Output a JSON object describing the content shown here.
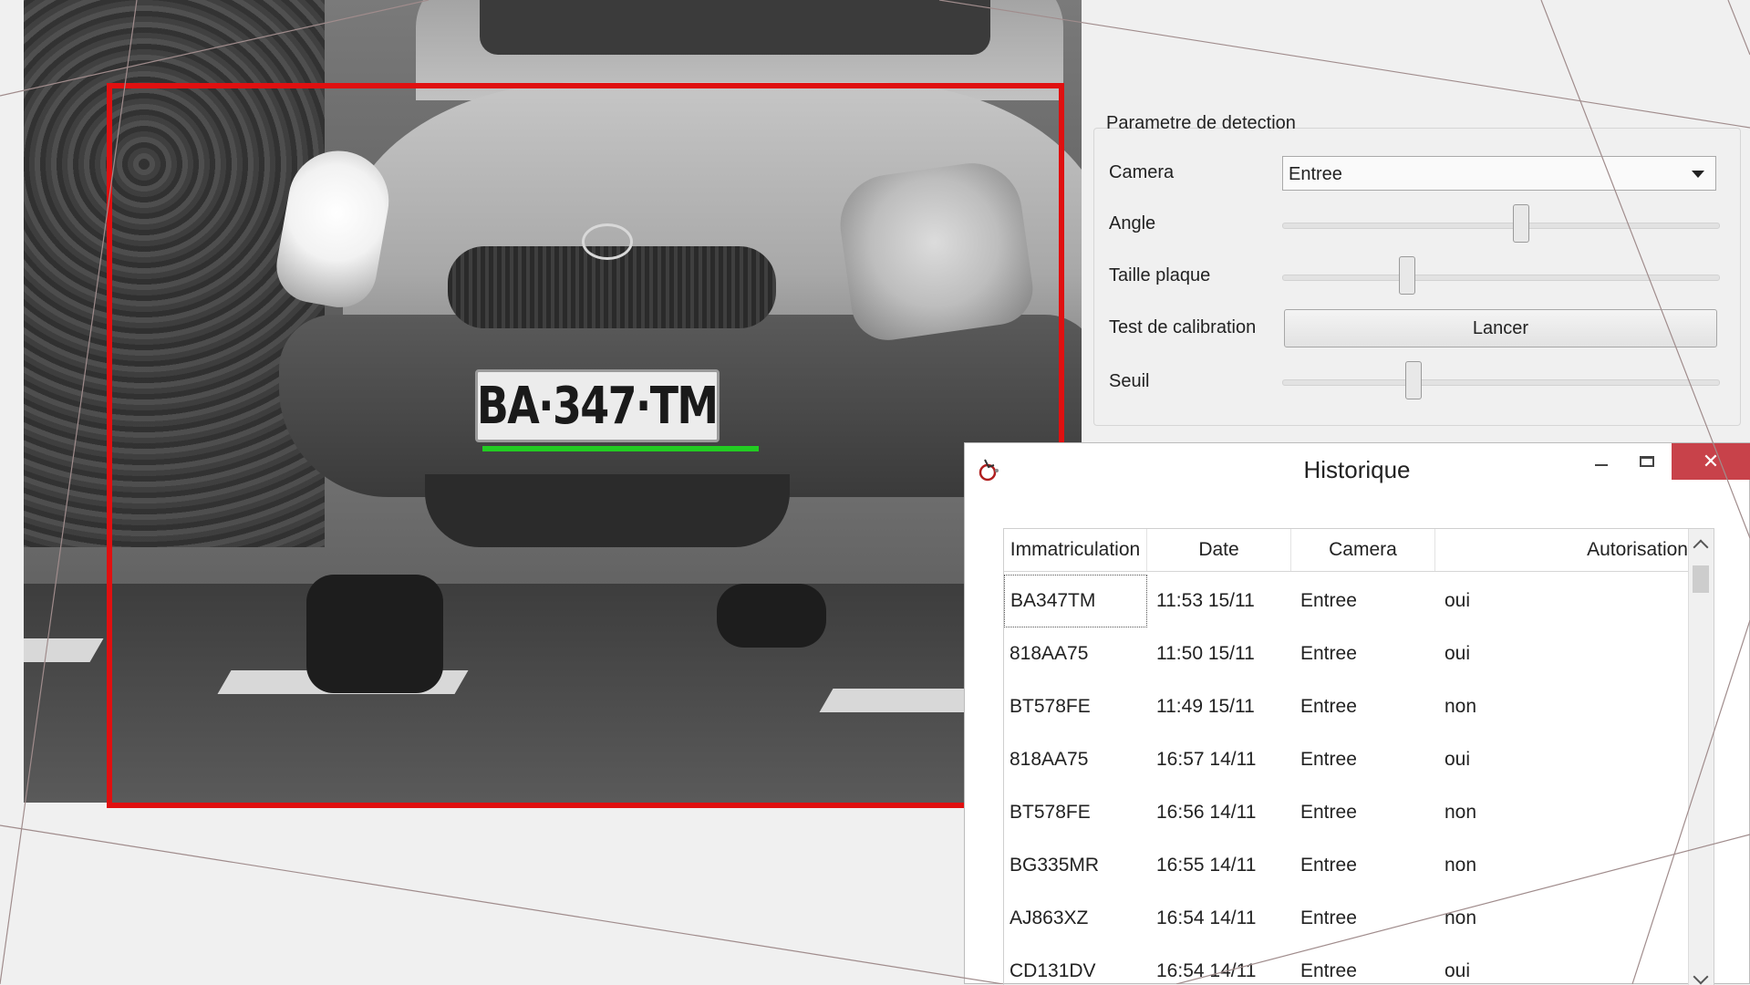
{
  "camera": {
    "plate_text": "BA·347·TM"
  },
  "detection_panel": {
    "title": "Parametre de detection",
    "camera_label": "Camera",
    "camera_value": "Entree",
    "angle_label": "Angle",
    "angle_level": 0.545,
    "plate_size_label": "Taille plaque",
    "plate_size_level": 0.285,
    "calibration_label": "Test de calibration",
    "calibration_button": "Lancer",
    "threshold_label": "Seuil",
    "threshold_level": 0.3
  },
  "history": {
    "title": "Historique",
    "close_glyph": "✕",
    "columns": [
      "Immatriculation",
      "Date",
      "Camera",
      "Autorisation"
    ],
    "rows": [
      {
        "plate": "BA347TM",
        "date": "11:53 15/11",
        "camera": "Entree",
        "authorized": "oui"
      },
      {
        "plate": "818AA75",
        "date": "11:50 15/11",
        "camera": "Entree",
        "authorized": "oui"
      },
      {
        "plate": "BT578FE",
        "date": "11:49 15/11",
        "camera": "Entree",
        "authorized": "non"
      },
      {
        "plate": "818AA75",
        "date": "16:57 14/11",
        "camera": "Entree",
        "authorized": "oui"
      },
      {
        "plate": "BT578FE",
        "date": "16:56 14/11",
        "camera": "Entree",
        "authorized": "non"
      },
      {
        "plate": "BG335MR",
        "date": "16:55 14/11",
        "camera": "Entree",
        "authorized": "non"
      },
      {
        "plate": "AJ863XZ",
        "date": "16:54 14/11",
        "camera": "Entree",
        "authorized": "non"
      },
      {
        "plate": "CD131DV",
        "date": "16:54 14/11",
        "camera": "Entree",
        "authorized": "oui"
      }
    ]
  },
  "colors": {
    "detection_box": "#e01010",
    "plate_line": "#22cc22",
    "close_button": "#c8424a"
  }
}
